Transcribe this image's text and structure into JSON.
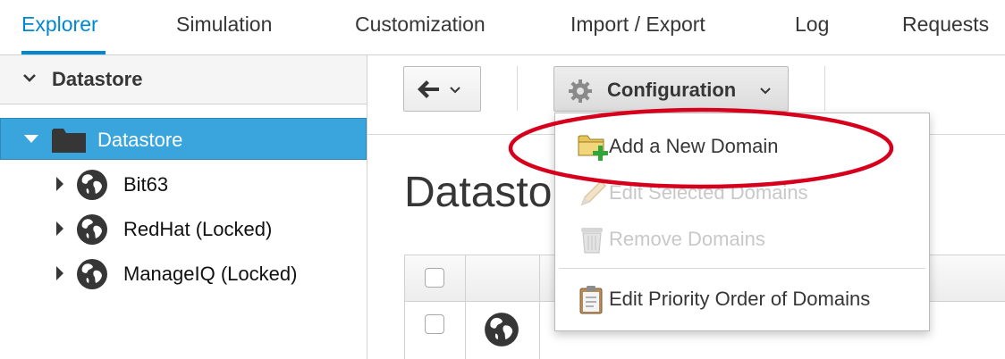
{
  "tabs": [
    {
      "label": "Explorer",
      "active": true
    },
    {
      "label": "Simulation",
      "active": false
    },
    {
      "label": "Customization",
      "active": false
    },
    {
      "label": "Import / Export",
      "active": false
    },
    {
      "label": "Log",
      "active": false
    },
    {
      "label": "Requests",
      "active": false
    }
  ],
  "sidebar": {
    "accordion_title": "Datastore",
    "tree": {
      "root": {
        "label": "Datastore",
        "icon": "folder-icon",
        "selected": true
      },
      "children": [
        {
          "label": "Bit63",
          "icon": "globe-icon"
        },
        {
          "label": "RedHat (Locked)",
          "icon": "globe-icon"
        },
        {
          "label": "ManageIQ (Locked)",
          "icon": "globe-icon"
        }
      ]
    }
  },
  "toolbar": {
    "back_button_icon": "arrow-left-icon",
    "configuration_label": "Configuration",
    "configuration_icon": "gear-icon"
  },
  "main": {
    "page_title": "Datasto"
  },
  "config_menu": {
    "items": [
      {
        "label": "Add a New Domain",
        "enabled": true,
        "icon": "folder-add-icon"
      },
      {
        "label": "Edit Selected Domains",
        "enabled": false,
        "icon": "pencil-icon"
      },
      {
        "label": "Remove Domains",
        "enabled": false,
        "icon": "trash-icon"
      },
      {
        "label": "Edit Priority Order of Domains",
        "enabled": true,
        "icon": "clipboard-icon"
      }
    ]
  },
  "colors": {
    "accent": "#0088ce",
    "selected_row": "#39a5dc",
    "highlight": "#d6001c"
  }
}
